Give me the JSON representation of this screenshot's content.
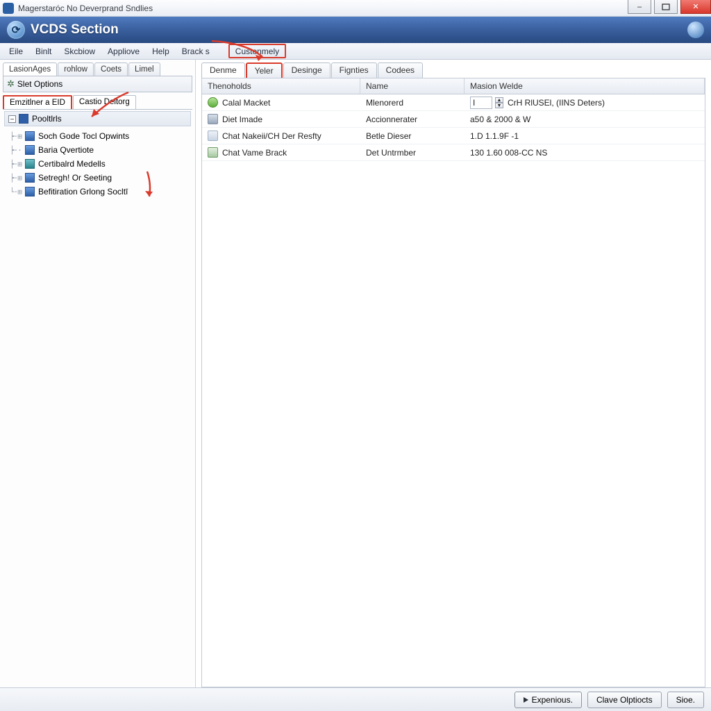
{
  "window": {
    "title": "Magerstaróc No Deverprand Sndlies"
  },
  "header": {
    "section_title": "VCDS Section"
  },
  "menu": {
    "items": [
      "Eile",
      "Binlt",
      "Skcbiow",
      "Appliove",
      "Help",
      "Brack s"
    ],
    "highlighted": "Custonmely"
  },
  "left_pane": {
    "tabs": [
      "LasionAges",
      "rohlow",
      "Coets",
      "Limel"
    ],
    "toolbar_label": "Slet Options",
    "subtabs": {
      "highlighted": "Emzitlner a EID",
      "other": "Castio Deltorg"
    },
    "tree": {
      "root": "Pooltlrls",
      "items": [
        "Soch Gode Tocl Opwints",
        "Baria Qvertiote",
        "Certibalrd Medells",
        "Setregh! Or Seeting",
        "Befitiration Grlong Socltī"
      ]
    }
  },
  "right_pane": {
    "tabs": [
      {
        "label": "Denme",
        "state": "active"
      },
      {
        "label": "Yeler",
        "state": "hl"
      },
      {
        "label": "Desinge",
        "state": ""
      },
      {
        "label": "Fignties",
        "state": ""
      },
      {
        "label": "Codees",
        "state": ""
      }
    ],
    "columns": [
      "Thenoholds",
      "Name",
      "Masion Welde"
    ],
    "rows": [
      {
        "icon": "ri-green",
        "c1": "Calal Macket",
        "c2": "Mlenorerd",
        "c3_input": "I",
        "c3_rest": "CrH RlUSEl, (IINS Deters)"
      },
      {
        "icon": "ri-cup",
        "c1": "Diet Imade",
        "c2": "Accionnerater",
        "c3": "a50 & 2000 & W"
      },
      {
        "icon": "ri-doc",
        "c1": "Chat Nakeii/CH Der Resfty",
        "c2": "Betle Dieser",
        "c3": "1.D 1.1.9F -1"
      },
      {
        "icon": "ri-doc2",
        "c1": "Chat Vame Brack",
        "c2": "Det Untrmber",
        "c3": "130 1.60 008-CC NS"
      }
    ]
  },
  "bottom": {
    "b1": "Expenious.",
    "b2": "Clave Olptiocts",
    "b3": "Sioe."
  }
}
